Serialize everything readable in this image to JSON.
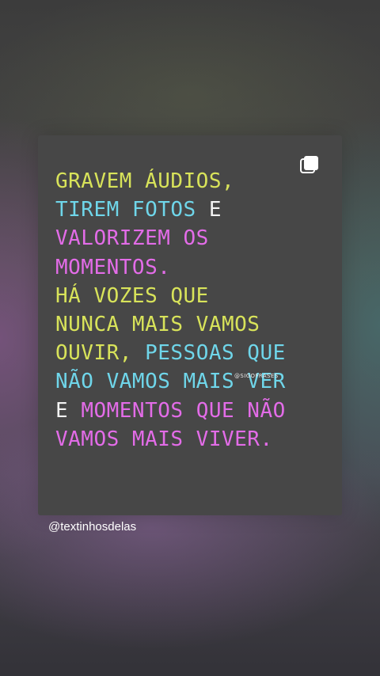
{
  "post": {
    "lines": [
      [
        {
          "text": "Gravem áudios,",
          "color": "yellow"
        }
      ],
      [
        {
          "text": "tirem fotos",
          "color": "cyan"
        },
        {
          "text": " e",
          "color": "white"
        }
      ],
      [
        {
          "text": "valorizem os",
          "color": "pink"
        }
      ],
      [
        {
          "text": "momentos.",
          "color": "pink"
        }
      ],
      [
        {
          "text": "Há vozes que",
          "color": "yellow"
        }
      ],
      [
        {
          "text": "nunca mais vamos",
          "color": "yellow"
        }
      ],
      [
        {
          "text": "ouvir, ",
          "color": "yellow"
        },
        {
          "text": "pessoas que",
          "color": "cyan"
        }
      ],
      [
        {
          "text": "não vamos mais ver",
          "color": "cyan"
        }
      ],
      [
        {
          "text": "e ",
          "color": "white"
        },
        {
          "text": "momentos que não",
          "color": "pink"
        }
      ],
      [
        {
          "text": "vamos mais viver.",
          "color": "pink"
        }
      ]
    ],
    "watermark": "@SIGOFRASES",
    "multi_icon": "multiple-posts-icon"
  },
  "story": {
    "mention": "@textinhosdelas"
  },
  "colors": {
    "yellow": "#d8e35a",
    "cyan": "#6fd6ea",
    "pink": "#e36ce8",
    "white": "#f3f3f3",
    "card": "#474747"
  }
}
